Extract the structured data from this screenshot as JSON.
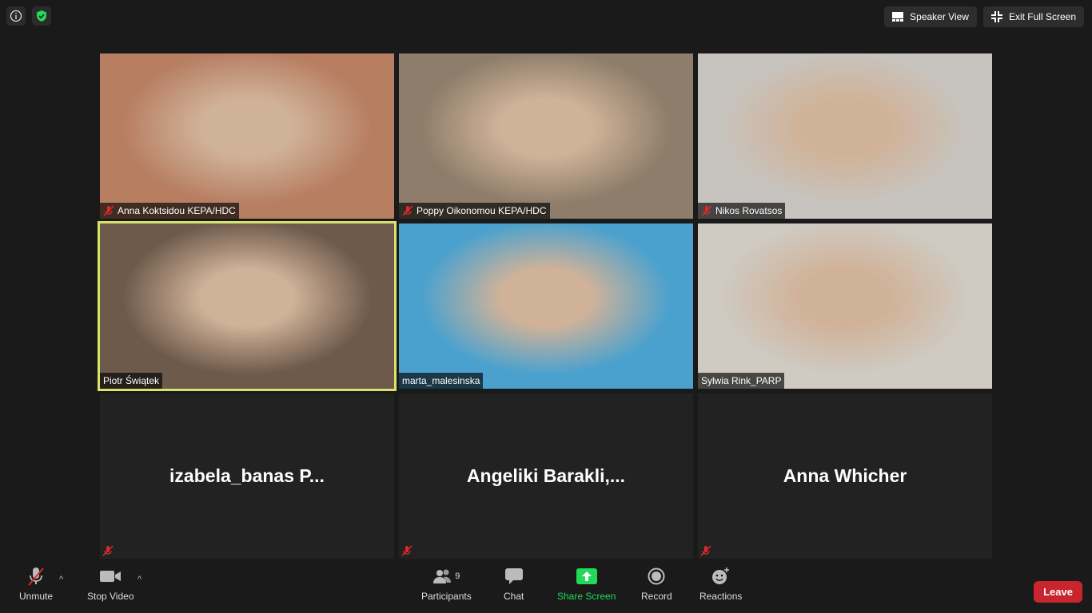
{
  "top_right": {
    "speaker_view": "Speaker View",
    "exit_full_screen": "Exit Full Screen"
  },
  "participants": [
    {
      "name": "Anna Koktsidou KEPA/HDC",
      "muted": true,
      "video": true,
      "bg": "#b77e62"
    },
    {
      "name": "Poppy Oikonomou KEPA/HDC",
      "muted": true,
      "video": true,
      "bg": "#8d7d6a"
    },
    {
      "name": "Nikos Rovatsos",
      "muted": true,
      "video": true,
      "bg": "#c7c4bf"
    },
    {
      "name": "Piotr Świątek",
      "muted": false,
      "video": true,
      "active": true,
      "bg": "#6e5a4b"
    },
    {
      "name": "marta_malesinska",
      "muted": false,
      "video": true,
      "bg": "#4aa1ce"
    },
    {
      "name": "Sylwia Rink_PARP",
      "muted": false,
      "video": true,
      "bg": "#cfcac2"
    },
    {
      "name": "izabela_banas  P...",
      "muted": true,
      "video": false
    },
    {
      "name": "Angeliki  Barakli,...",
      "muted": true,
      "video": false
    },
    {
      "name": "Anna Whicher",
      "muted": true,
      "video": false
    }
  ],
  "toolbar": {
    "unmute": "Unmute",
    "stop_video": "Stop Video",
    "participants": "Participants",
    "participants_count": "9",
    "chat": "Chat",
    "share_screen": "Share Screen",
    "record": "Record",
    "reactions": "Reactions",
    "leave": "Leave"
  },
  "colors": {
    "share_green": "#23d959",
    "leave_red": "#c8252e",
    "active_border": "#d8e36b",
    "mute_red": "#e02828"
  }
}
